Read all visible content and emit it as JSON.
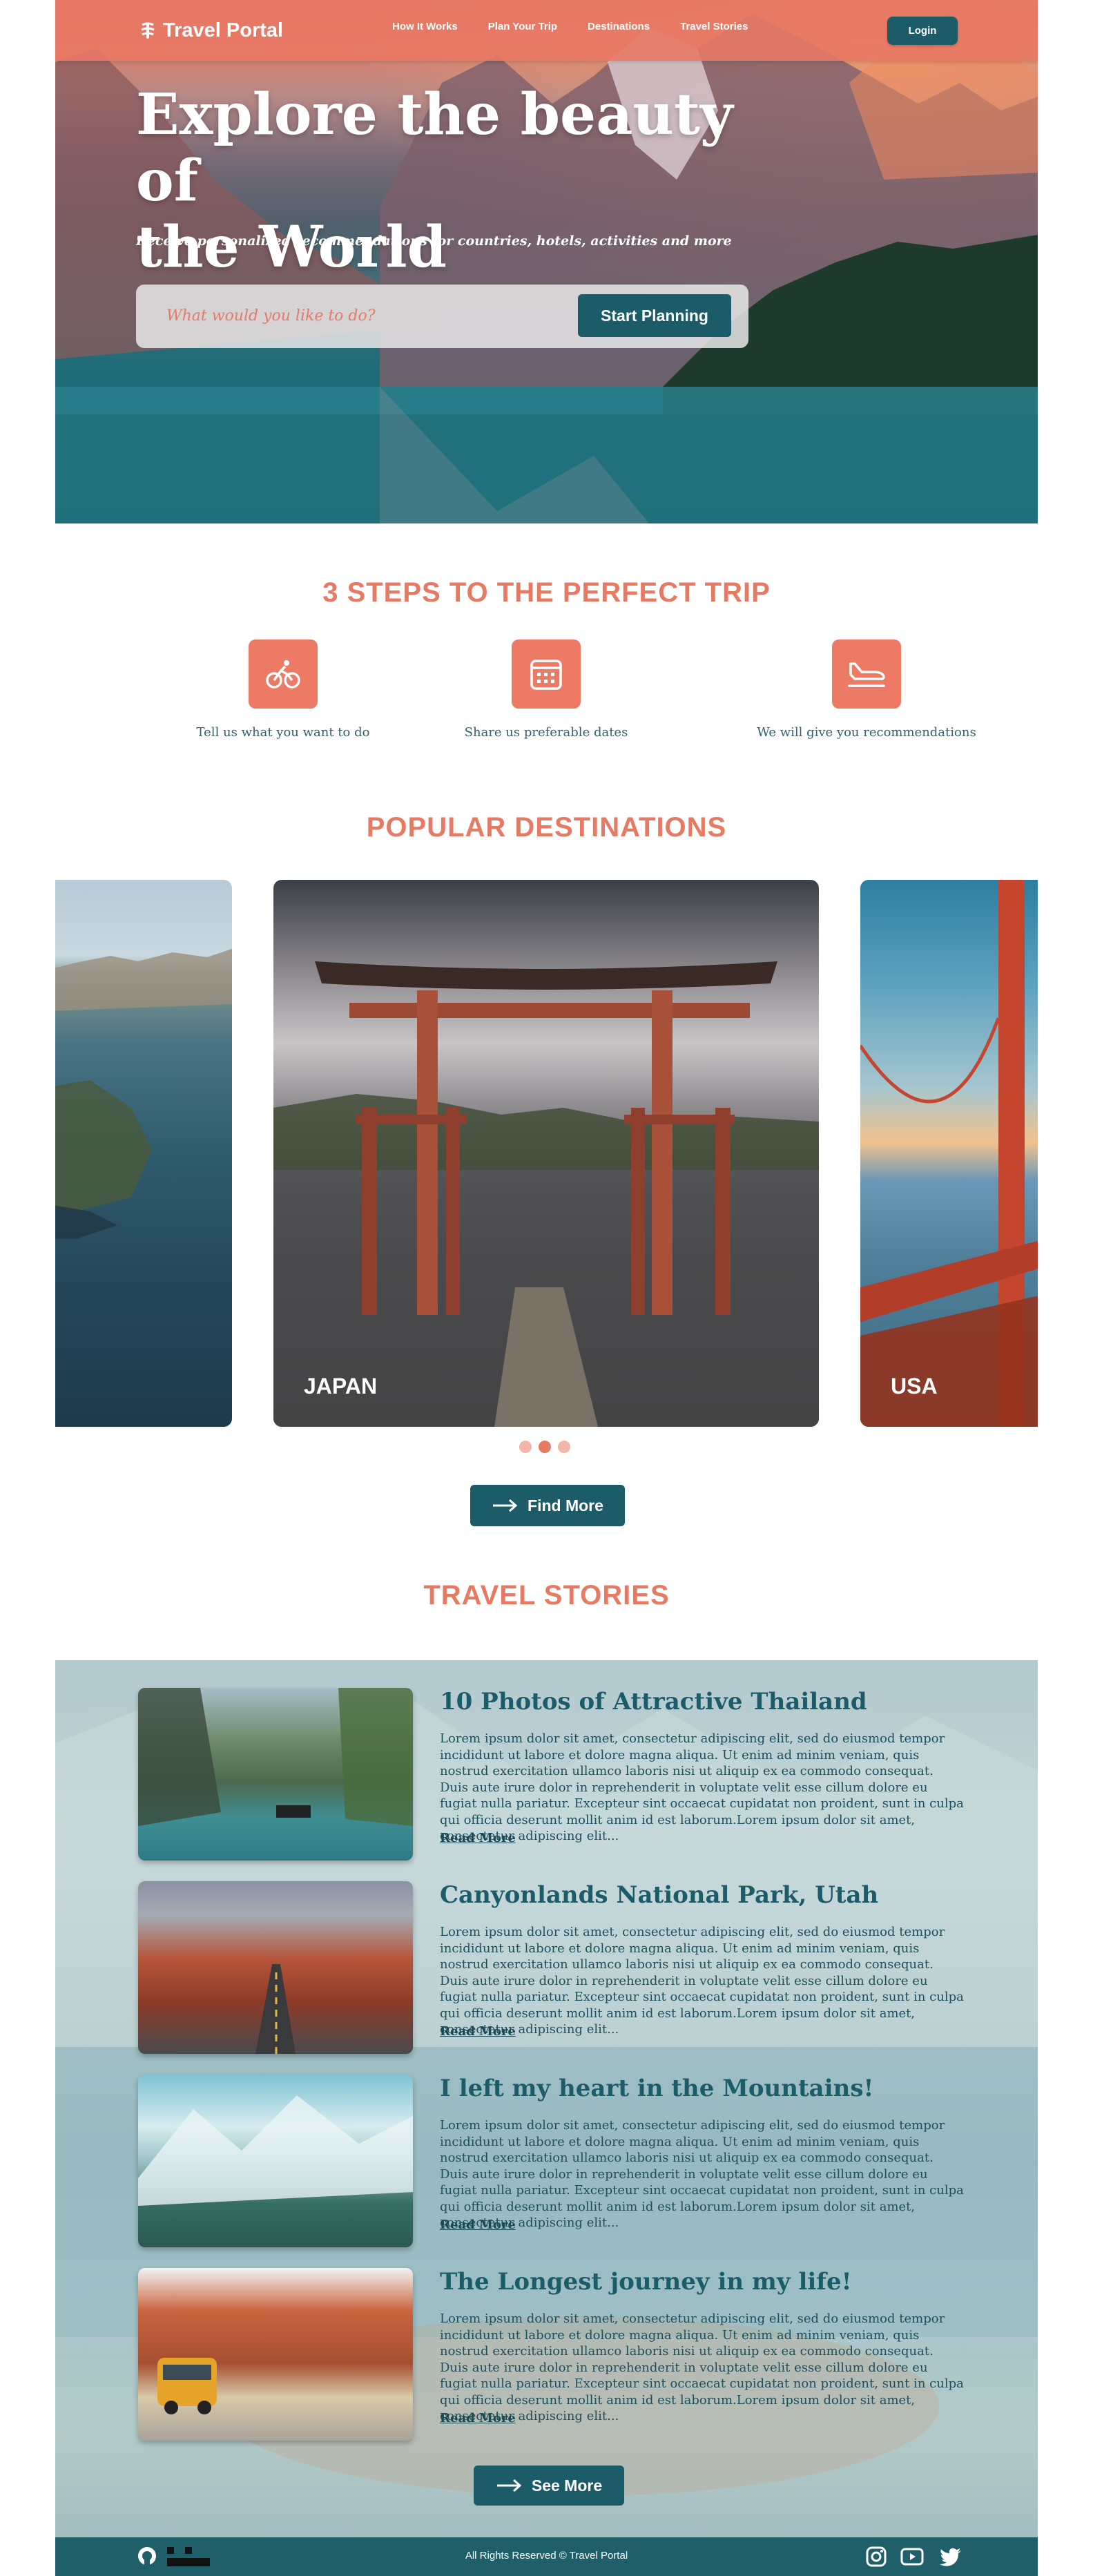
{
  "nav": {
    "brand": "Travel Portal",
    "links": [
      "How It Works",
      "Plan Your Trip",
      "Destinations",
      "Travel Stories"
    ],
    "login": "Login"
  },
  "hero": {
    "title_line1": "Explore the beauty of",
    "title_line2": "the World",
    "subtitle": "Receive personalized recommendations for countries, hotels, activities and more",
    "search_placeholder": "What would you like to do?",
    "cta": "Start Planning"
  },
  "steps": {
    "title": "3 STEPS TO THE PERFECT TRIP",
    "items": [
      {
        "label": "Tell us what you want to do",
        "icon": "bicycle-icon"
      },
      {
        "label": "Share us preferable dates",
        "icon": "calendar-icon"
      },
      {
        "label": "We will give you recommendations",
        "icon": "plane-landing-icon"
      }
    ]
  },
  "destinations": {
    "title": "POPULAR DESTINATIONS",
    "cards": [
      {
        "label": ""
      },
      {
        "label": "JAPAN"
      },
      {
        "label": "USA"
      }
    ],
    "carousel_active_index": 1,
    "carousel_count": 3,
    "button": "Find More"
  },
  "stories": {
    "title": "TRAVEL STORIES",
    "items": [
      {
        "title": "10 Photos of Attractive Thailand",
        "text": "Lorem ipsum dolor sit amet, consectetur adipiscing elit, sed do eiusmod tempor incididunt ut labore et dolore magna aliqua. Ut enim ad minim veniam, quis nostrud exercitation ullamco laboris nisi ut aliquip ex ea commodo consequat. Duis aute irure dolor in reprehenderit in voluptate velit esse cillum dolore eu fugiat nulla pariatur. Excepteur sint occaecat cupidatat non proident, sunt in culpa qui officia deserunt mollit anim id est laborum.Lorem ipsum dolor sit amet, consectetur adipiscing elit...",
        "more": "Read More"
      },
      {
        "title": "Canyonlands National Park, Utah",
        "text": "Lorem ipsum dolor sit amet, consectetur adipiscing elit, sed do eiusmod tempor incididunt ut labore et dolore magna aliqua. Ut enim ad minim veniam, quis nostrud exercitation ullamco laboris nisi ut aliquip ex ea commodo consequat. Duis aute irure dolor in reprehenderit in voluptate velit esse cillum dolore eu fugiat nulla pariatur. Excepteur sint occaecat cupidatat non proident, sunt in culpa qui officia deserunt mollit anim id est laborum.Lorem ipsum dolor sit amet, consectetur adipiscing elit...",
        "more": "Read More"
      },
      {
        "title": "I left my heart in the Mountains!",
        "text": "Lorem ipsum dolor sit amet, consectetur adipiscing elit, sed do eiusmod tempor incididunt ut labore et dolore magna aliqua. Ut enim ad minim veniam, quis nostrud exercitation ullamco laboris nisi ut aliquip ex ea commodo consequat. Duis aute irure dolor in reprehenderit in voluptate velit esse cillum dolore eu fugiat nulla pariatur. Excepteur sint occaecat cupidatat non proident, sunt in culpa qui officia deserunt mollit anim id est laborum.Lorem ipsum dolor sit amet, consectetur adipiscing elit...",
        "more": "Read More"
      },
      {
        "title": "The Longest journey in my life!",
        "text": "Lorem ipsum dolor sit amet, consectetur adipiscing elit, sed do eiusmod tempor incididunt ut labore et dolore magna aliqua. Ut enim ad minim veniam, quis nostrud exercitation ullamco laboris nisi ut aliquip ex ea commodo consequat. Duis aute irure dolor in reprehenderit in voluptate velit esse cillum dolore eu fugiat nulla pariatur. Excepteur sint occaecat cupidatat non proident, sunt in culpa qui officia deserunt mollit anim id est laborum.Lorem ipsum dolor sit amet, consectetur adipiscing elit...",
        "more": "Read More"
      }
    ],
    "button": "See More"
  },
  "footer": {
    "copyright": "All Rights Reserved © Travel Portal",
    "icons": [
      "github-icon",
      "rs-school-logo",
      "instagram-icon",
      "youtube-icon",
      "twitter-icon"
    ]
  },
  "colors": {
    "accent": "#e67a63",
    "primary": "#1b5c68",
    "nav_bg": "#e87864"
  }
}
